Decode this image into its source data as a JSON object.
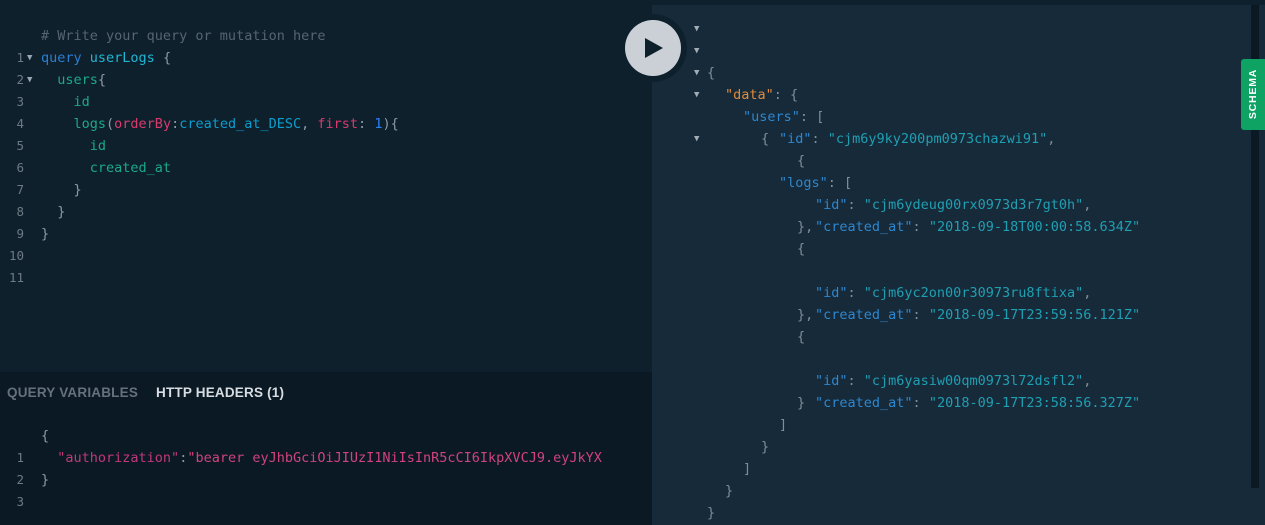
{
  "query_editor": {
    "lines": [
      {
        "n": "1"
      },
      {
        "n": "2"
      },
      {
        "n": "3"
      },
      {
        "n": "4"
      },
      {
        "n": "5"
      },
      {
        "n": "6"
      },
      {
        "n": "7"
      },
      {
        "n": "8"
      },
      {
        "n": "9"
      },
      {
        "n": "10"
      },
      {
        "n": "11"
      }
    ],
    "comment": "# Write your query or mutation here",
    "kw_query": "query",
    "op_name": "userLogs",
    "users": "users",
    "id": "id",
    "logs": "logs",
    "arg_orderBy": "orderBy",
    "enum_value": "created_at_DESC",
    "arg_first": "first",
    "num_value": "1",
    "created_at": "created_at"
  },
  "variables_panel": {
    "tab_query_variables": "QUERY VARIABLES",
    "tab_http_headers": "HTTP HEADERS (1)",
    "line_numbers": [
      "1",
      "2",
      "3"
    ],
    "header_key": "\"authorization\"",
    "header_value": "\"bearer eyJhbGciOiJIUzI1NiIsInR5cCI6IkpXVCJ9.eyJkYX"
  },
  "run_button": {
    "icon": "play-icon"
  },
  "result": {
    "data_key": "\"data\"",
    "users_key": "\"users\"",
    "id_key": "\"id\"",
    "user_id": "\"cjm6y9ky200pm0973chazwi91\"",
    "logs_key": "\"logs\"",
    "created_at_key": "\"created_at\"",
    "logs": [
      {
        "id": "\"cjm6ydeug00rx0973d3r7gt0h\"",
        "created_at": "\"2018-09-18T00:00:58.634Z\""
      },
      {
        "id": "\"cjm6yc2on00r30973ru8ftixa\"",
        "created_at": "\"2018-09-17T23:59:56.121Z\""
      },
      {
        "id": "\"cjm6yasiw00qm0973l72dsfl2\"",
        "created_at": "\"2018-09-17T23:58:56.327Z\""
      }
    ]
  },
  "schema_tab": {
    "label": "SCHEMA",
    "color": "#0ea363"
  },
  "colors": {
    "editor_bg": "#0f202d",
    "result_bg": "#172a3a",
    "accent_green": "#0ea363"
  }
}
